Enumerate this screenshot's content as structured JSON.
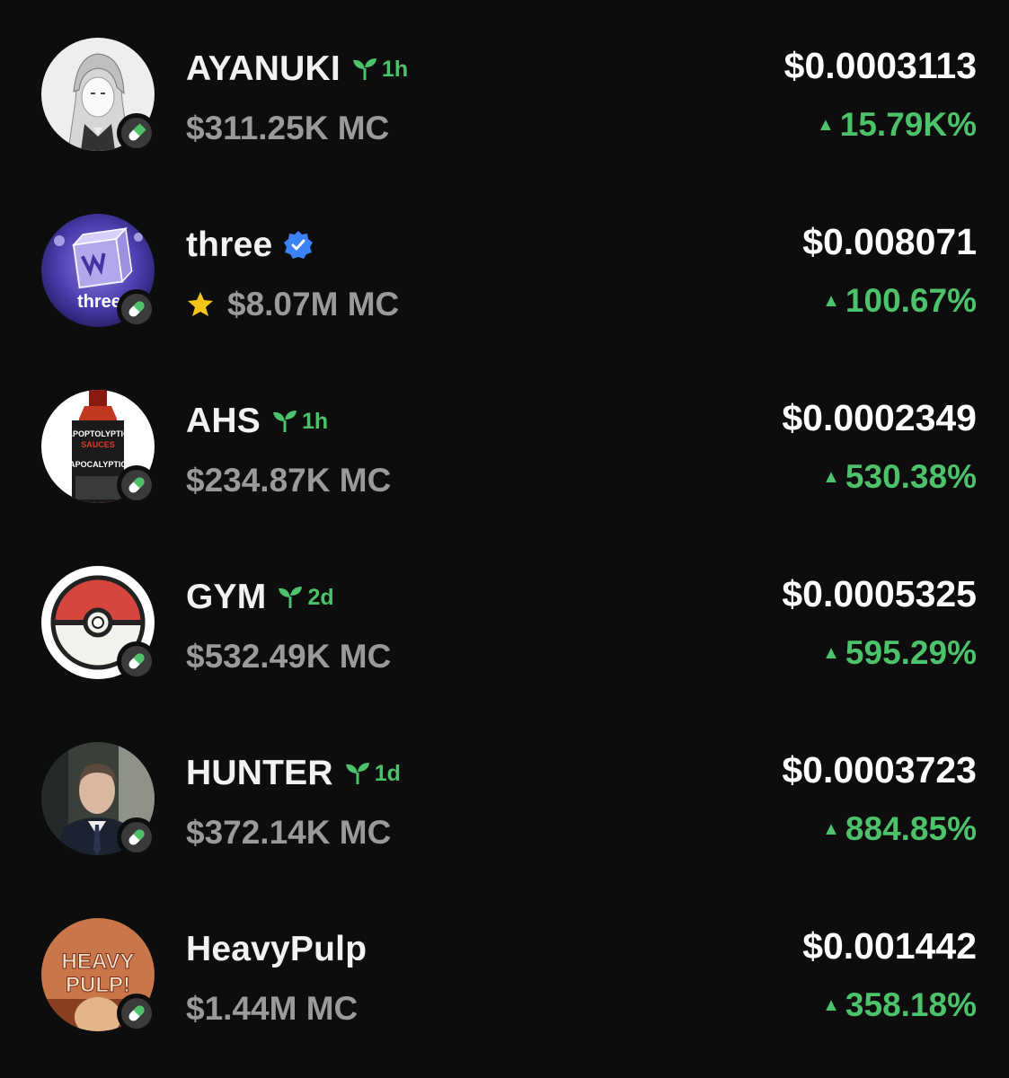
{
  "tokens": [
    {
      "name": "AYANUKI",
      "age": "1h",
      "market_cap": "$311.25K MC",
      "price": "$0.0003113",
      "change": "15.79K%"
    },
    {
      "name": "three",
      "age": "",
      "market_cap": "$8.07M MC",
      "price": "$0.008071",
      "change": "100.67%",
      "avatar_text": "three."
    },
    {
      "name": "AHS",
      "age": "1h",
      "market_cap": "$234.87K MC",
      "price": "$0.0002349",
      "change": "530.38%",
      "avatar_text": "APOPTOLYPTIC SAUCES APOCALYPTIC"
    },
    {
      "name": "GYM",
      "age": "2d",
      "market_cap": "$532.49K MC",
      "price": "$0.0005325",
      "change": "595.29%"
    },
    {
      "name": "HUNTER",
      "age": "1d",
      "market_cap": "$372.14K MC",
      "price": "$0.0003723",
      "change": "884.85%"
    },
    {
      "name": "HeavyPulp",
      "age": "",
      "market_cap": "$1.44M MC",
      "price": "$0.001442",
      "change": "358.18%",
      "avatar_text": "HEAVY PULP!"
    }
  ],
  "icons": {
    "age": "seedling-icon",
    "verified": "verified-badge-icon",
    "featured": "star-icon",
    "platform": "pill-icon",
    "change": "up-triangle-icon"
  },
  "colors": {
    "background": "#0d0d0d",
    "positive": "#4cc26a",
    "verified": "#3b82f6",
    "star": "#f5c518"
  }
}
